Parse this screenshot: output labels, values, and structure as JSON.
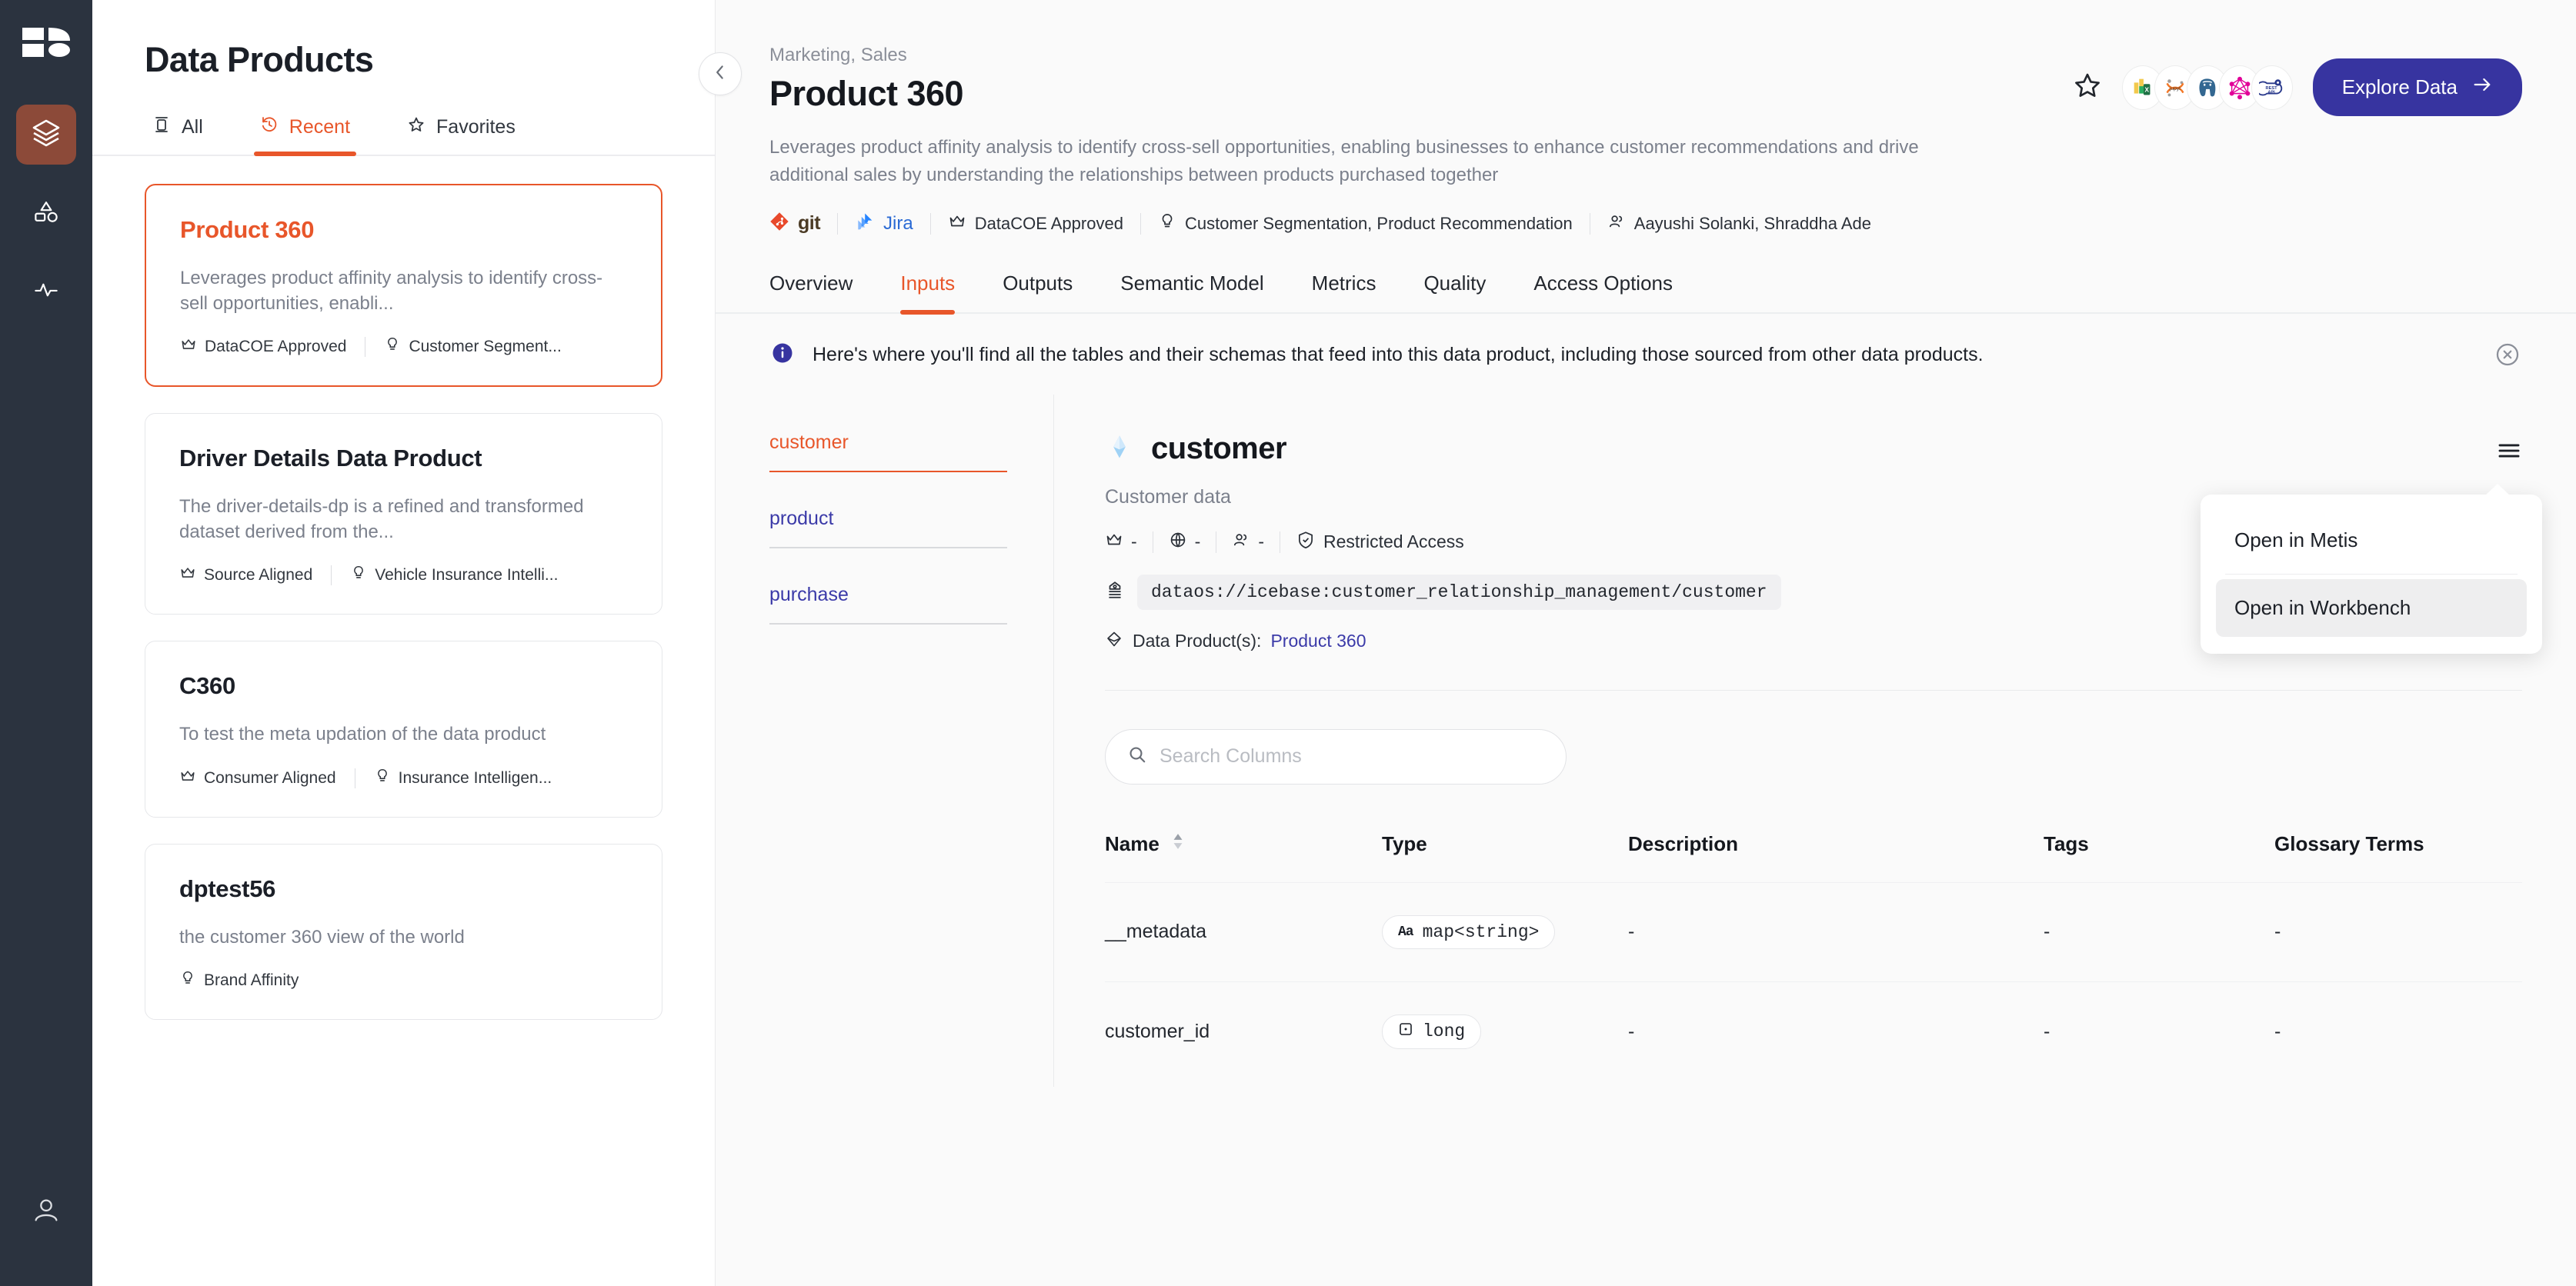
{
  "rail": {
    "items": [
      {
        "name": "logo",
        "icon": "brand-logo-icon"
      },
      {
        "name": "data-products",
        "icon": "layers-icon",
        "active": true
      },
      {
        "name": "shapes",
        "icon": "shapes-icon",
        "active": false
      },
      {
        "name": "activity",
        "icon": "pulse-icon",
        "active": false
      }
    ],
    "bottom": {
      "name": "profile",
      "icon": "user-icon"
    }
  },
  "left_panel": {
    "title": "Data Products",
    "tabs": [
      {
        "label": "All",
        "icon": "database-icon",
        "active": false
      },
      {
        "label": "Recent",
        "icon": "history-icon",
        "active": true
      },
      {
        "label": "Favorites",
        "icon": "star-icon",
        "active": false
      }
    ],
    "cards": [
      {
        "title": "Product 360",
        "description": "Leverages product affinity analysis to identify cross-sell opportunities, enabli...",
        "tier": "DataCOE Approved",
        "domain": "Customer Segment...",
        "selected": true
      },
      {
        "title": "Driver Details Data Product",
        "description": "The driver-details-dp is a refined and transformed dataset derived from the...",
        "tier": "Source Aligned",
        "domain": "Vehicle Insurance Intelli...",
        "selected": false
      },
      {
        "title": "C360",
        "description": "To test the meta updation of the data product",
        "tier": "Consumer Aligned",
        "domain": "Insurance Intelligen...",
        "selected": false
      },
      {
        "title": "dptest56",
        "description": "the customer 360 view of the world",
        "tier": "",
        "domain": "Brand Affinity",
        "selected": false
      }
    ]
  },
  "header": {
    "breadcrumb": "Marketing, Sales",
    "title": "Product 360",
    "description": "Leverages product affinity analysis to identify cross-sell opportunities, enabling businesses to enhance customer recommendations and drive additional sales by understanding the relationships between products purchased together",
    "meta": {
      "git_label": "git",
      "jira_label": "Jira",
      "tier": "DataCOE Approved",
      "use_cases": "Customer Segmentation, Product Recommendation",
      "owners": "Aayushi Solanki, Shraddha Ade"
    },
    "favorite_icon": "star-icon",
    "avatars": [
      "excel-icon",
      "jupyter-icon",
      "postgres-icon",
      "graphql-icon",
      "rest-api-icon"
    ],
    "explore_button": "Explore Data"
  },
  "tabs": [
    {
      "label": "Overview",
      "active": false
    },
    {
      "label": "Inputs",
      "active": true
    },
    {
      "label": "Outputs",
      "active": false
    },
    {
      "label": "Semantic Model",
      "active": false
    },
    {
      "label": "Metrics",
      "active": false
    },
    {
      "label": "Quality",
      "active": false
    },
    {
      "label": "Access Options",
      "active": false
    }
  ],
  "banner": {
    "text": "Here's where you'll find all the tables and their schemas that feed into this data product, including those sourced from other data products.",
    "info_icon": "info-icon",
    "close_icon": "close-circle-icon"
  },
  "table_list": [
    {
      "label": "customer",
      "active": true
    },
    {
      "label": "product",
      "active": false
    },
    {
      "label": "purchase",
      "active": false
    }
  ],
  "detail": {
    "icon": "iceberg-icon",
    "title": "customer",
    "subtitle": "Customer data",
    "tier": "-",
    "globe": "-",
    "owner": "-",
    "access": "Restricted Access",
    "uri": "dataos://icebase:customer_relationship_management/customer",
    "data_products_label": "Data Product(s):",
    "data_product_link": "Product 360"
  },
  "search": {
    "placeholder": "Search Columns",
    "value": "",
    "icon": "search-icon"
  },
  "columns_table": {
    "headers": [
      "Name",
      "Type",
      "Description",
      "Tags",
      "Glossary Terms"
    ],
    "sort_icon": "sort-icon",
    "rows": [
      {
        "name": "__metadata",
        "type": "map<string>",
        "type_icon": "text-type-icon",
        "description": "-",
        "tags": "-",
        "glossary": "-"
      },
      {
        "name": "customer_id",
        "type": "long",
        "type_icon": "number-type-icon",
        "description": "-",
        "tags": "-",
        "glossary": "-"
      }
    ]
  },
  "menu": {
    "hamburger_icon": "hamburger-icon",
    "items": [
      {
        "label": "Open in Metis",
        "highlight": false
      },
      {
        "label": "Open in Workbench",
        "highlight": true
      }
    ]
  },
  "colors": {
    "accent": "#e8562a",
    "rail_bg": "#2b333f",
    "rail_active": "#8c4a39",
    "primary_button": "#3734a0",
    "link": "#3b3aa8",
    "info": "#3734a0"
  }
}
